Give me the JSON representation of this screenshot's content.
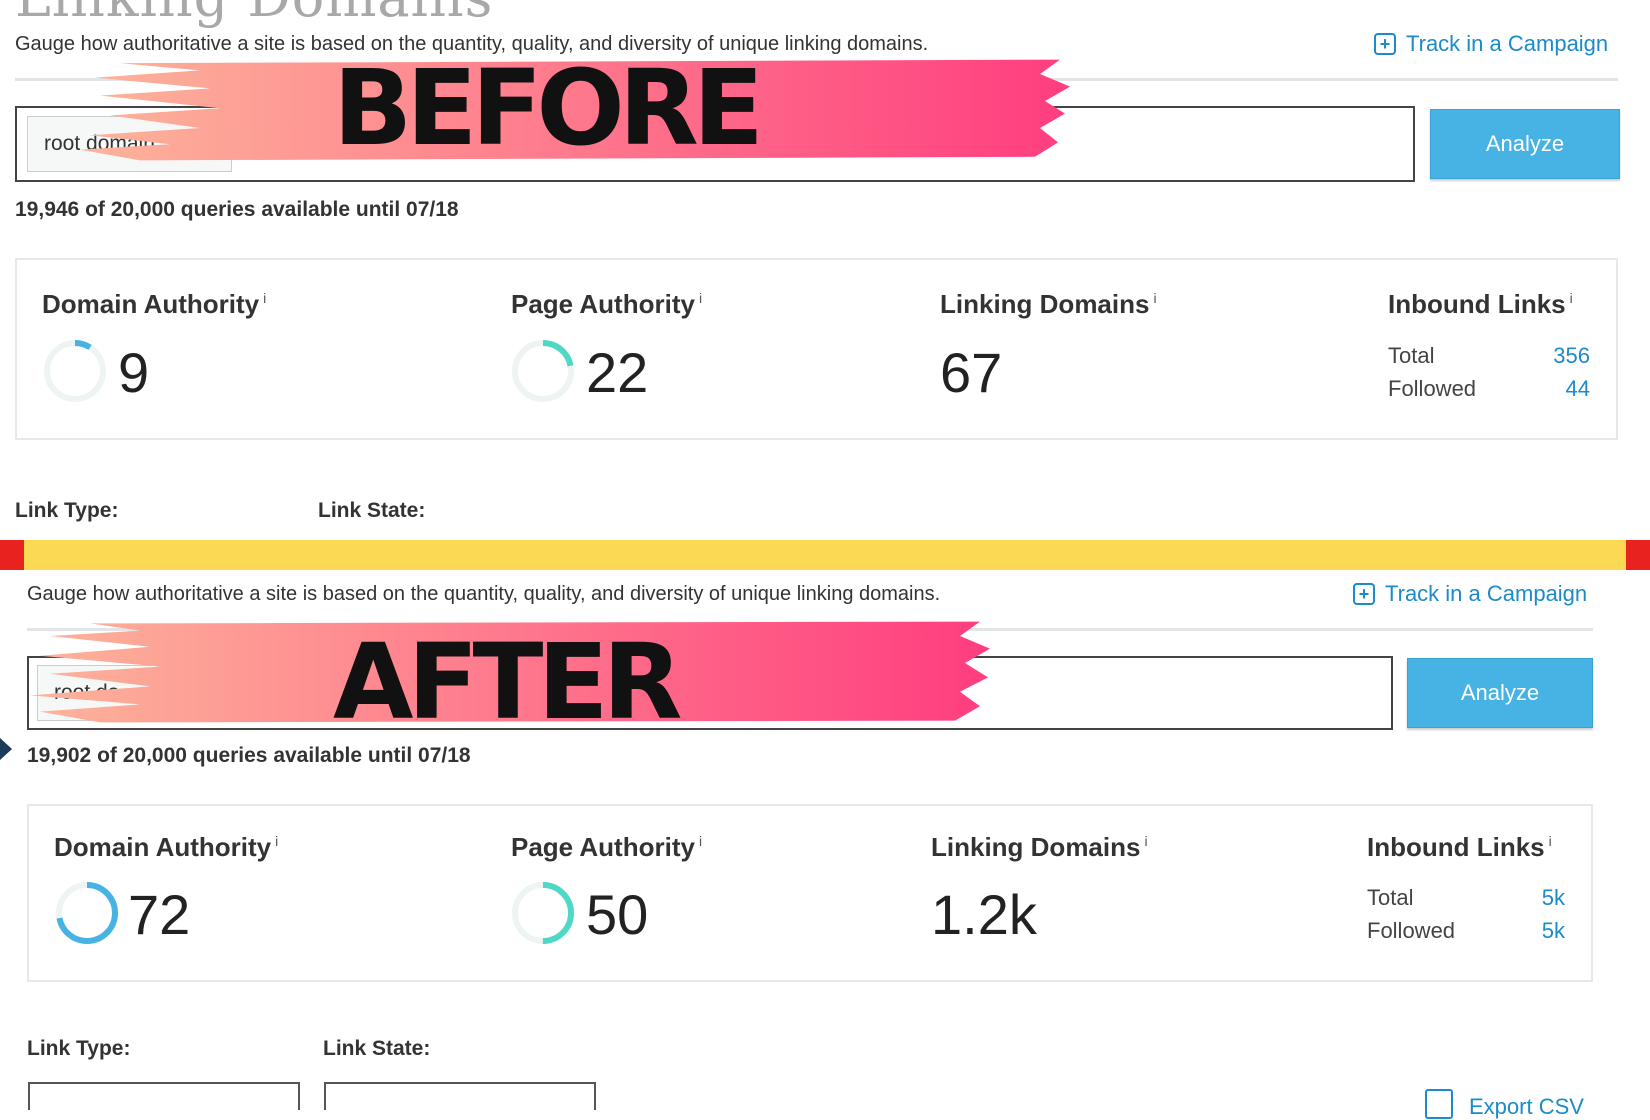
{
  "page": {
    "title": "Linking Domains"
  },
  "before": {
    "banner": "BEFORE",
    "description": "Gauge how authoritative a site is based on the quantity, quality, and diversity of unique linking domains.",
    "track_label": "Track in a Campaign",
    "select_value": "root domain",
    "analyze_label": "Analyze",
    "quota": "19,946 of 20,000 queries available until 07/18",
    "stats": {
      "domain_authority": {
        "label": "Domain Authority",
        "info": "i",
        "value": "9",
        "level": 0.09
      },
      "page_authority": {
        "label": "Page Authority",
        "info": "i",
        "value": "22",
        "level": 0.22
      },
      "linking_domains": {
        "label": "Linking Domains",
        "info": "i",
        "value": "67"
      },
      "inbound_links": {
        "label": "Inbound Links",
        "info": "i",
        "total_label": "Total",
        "total_value": "356",
        "followed_label": "Followed",
        "followed_value": "44"
      }
    },
    "filters": {
      "link_type_label": "Link Type:",
      "link_state_label": "Link State:"
    }
  },
  "after": {
    "banner": "AFTER",
    "description": "Gauge how authoritative a site is based on the quantity, quality, and diversity of unique linking domains.",
    "track_label": "Track in a Campaign",
    "select_value": "root do...",
    "analyze_label": "Analyze",
    "quota": "19,902 of 20,000 queries available until 07/18",
    "stats": {
      "domain_authority": {
        "label": "Domain Authority",
        "info": "i",
        "value": "72",
        "level": 0.72
      },
      "page_authority": {
        "label": "Page Authority",
        "info": "i",
        "value": "50",
        "level": 0.5
      },
      "linking_domains": {
        "label": "Linking Domains",
        "info": "i",
        "value": "1.2k"
      },
      "inbound_links": {
        "label": "Inbound Links",
        "info": "i",
        "total_label": "Total",
        "total_value": "5k",
        "followed_label": "Followed",
        "followed_value": "5k"
      }
    },
    "filters": {
      "link_type_label": "Link Type:",
      "link_state_label": "Link State:",
      "export_label": "Export CSV"
    }
  },
  "colors": {
    "da_ring": "#47b2e4",
    "pa_ring": "#4fd8c4",
    "ring_track": "#eef3f4",
    "link": "#1b8bc9",
    "divider": "#fcd955",
    "divider_edge": "#e8231f",
    "brush_start": "#fdb49a",
    "brush_end": "#ff3d7f"
  }
}
